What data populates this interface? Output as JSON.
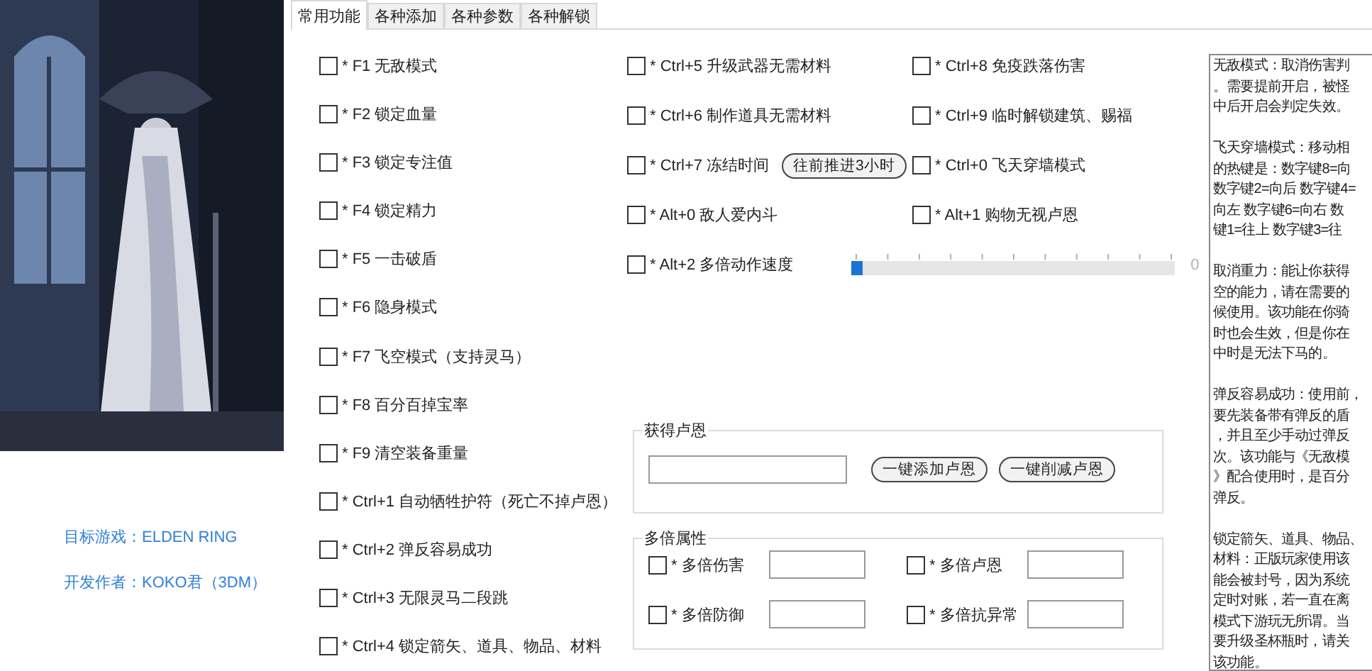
{
  "sidebar": {
    "picture": {
      "kind": "picture"
    },
    "info": [
      "目标游戏：ELDEN RING",
      "开发作者：KOKO君（3DM）"
    ]
  },
  "tabs": [
    {
      "label": "常用功能",
      "selected": true
    },
    {
      "label": "各种添加",
      "selected": false
    },
    {
      "label": "各种参数",
      "selected": false
    },
    {
      "label": "各种解锁",
      "selected": false
    }
  ],
  "left_options": [
    {
      "label": "* F1 无敌模式",
      "checked": false
    },
    {
      "label": "* F2 锁定血量",
      "checked": false
    },
    {
      "label": "* F3 锁定专注值",
      "checked": false
    },
    {
      "label": "* F4 锁定精力",
      "checked": false
    },
    {
      "label": "* F5 一击破盾",
      "checked": false
    },
    {
      "label": "* F6 隐身模式",
      "checked": false
    },
    {
      "label": "* F7 飞空模式（支持灵马）",
      "checked": false
    },
    {
      "label": "* F8 百分百掉宝率",
      "checked": false
    },
    {
      "label": "* F9 清空装备重量",
      "checked": false
    },
    {
      "label": "* Ctrl+1 自动牺牲护符（死亡不掉卢恩）",
      "checked": false
    },
    {
      "label": "* Ctrl+2 弹反容易成功",
      "checked": false
    },
    {
      "label": "* Ctrl+3 无限灵马二段跳",
      "checked": false
    },
    {
      "label": "* Ctrl+4 锁定箭矢、道具、物品、材料",
      "checked": false
    }
  ],
  "middle_options": [
    {
      "kind": "check",
      "label": "* Ctrl+5 升级武器无需材料",
      "checked": false
    },
    {
      "kind": "check",
      "label": "* Ctrl+6 制作道具无需材料",
      "checked": false
    },
    {
      "kind": "button",
      "label": "* Ctrl+7 冻结时间",
      "checked": false,
      "button": "往前推进3小时"
    },
    {
      "kind": "check",
      "label": "* Alt+0 敌人爱内斗",
      "checked": false
    },
    {
      "kind": "slider",
      "label": "* Alt+2 多倍动作速度",
      "checked": false,
      "level": 0,
      "reading": "0"
    }
  ],
  "right_options": [
    {
      "label": "* Ctrl+8 免疫跌落伤害",
      "checked": false
    },
    {
      "label": "* Ctrl+9 临时解锁建筑、赐福",
      "checked": false
    },
    {
      "label": "* Ctrl+0 飞天穿墙模式",
      "checked": false
    },
    {
      "label": "* Alt+1 购物无视卢恩",
      "checked": false
    }
  ],
  "runes_group": {
    "title": "获得卢恩",
    "buttons": [
      "一键添加卢恩",
      "一键削减卢恩"
    ]
  },
  "multiplier_group": {
    "title": "多倍属性",
    "items": [
      {
        "label": "* 多倍伤害",
        "checked": false
      },
      {
        "label": "* 多倍卢恩",
        "checked": false
      },
      {
        "label": "* 多倍防御",
        "checked": false
      },
      {
        "label": "* 多倍抗异常",
        "checked": false
      }
    ]
  },
  "notes": [
    [
      "无敌模式：取消伤害判",
      "。需要提前开启，被怪",
      "中后开启会判定失效。"
    ],
    [
      "飞天穿墙模式：移动相",
      "的热键是：数字键8=向",
      "数字键2=向后 数字键4=",
      "向左 数字键6=向右 数",
      "键1=往上 数字键3=往"
    ],
    [
      "取消重力：能让你获得",
      "空的能力，请在需要的",
      "候使用。该功能在你骑",
      "时也会生效，但是你在",
      "中时是无法下马的。"
    ],
    [
      "弹反容易成功：使用前，",
      "要先装备带有弹反的盾",
      "，并且至少手动过弹反",
      "次。该功能与《无敌模",
      "》配合使用时，是百分",
      "弹反。"
    ],
    [
      "锁定箭矢、道具、物品、",
      "材料：正版玩家使用该",
      "能会被封号，因为系统",
      "定时对账，若一直在离",
      "模式下游玩无所谓。当",
      "要升级圣杯瓶时，请关",
      "该功能。"
    ]
  ]
}
